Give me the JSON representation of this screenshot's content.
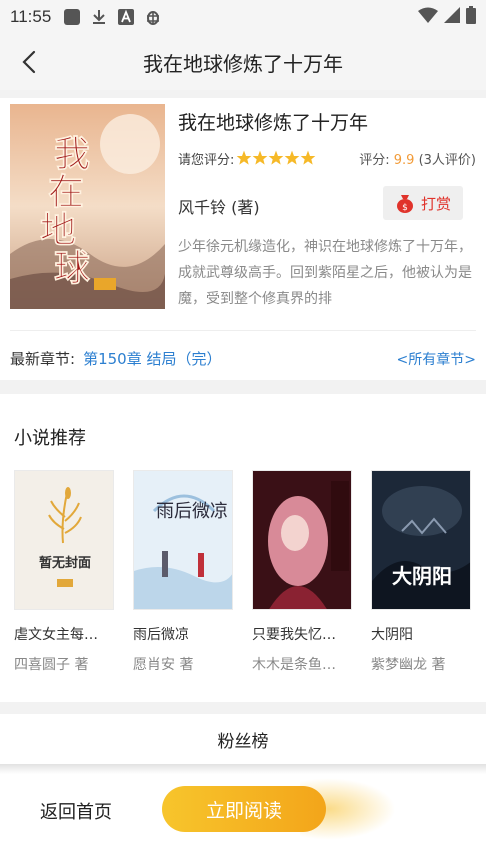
{
  "status_bar": {
    "time": "11:55",
    "icons_left": [
      "app-square-icon",
      "download-icon",
      "a-badge-icon",
      "bug-icon"
    ],
    "icons_right": [
      "wifi-icon",
      "signal-icon",
      "battery-icon"
    ]
  },
  "nav": {
    "title": "我在地球修炼了十万年"
  },
  "book": {
    "title": "我在地球修炼了十万年",
    "rating_label": "请您评分:",
    "stars": 5,
    "score_label": "评分:",
    "score_value": "9.9",
    "score_count": "(3人评价)",
    "author": "风千铃 (著)",
    "reward_label": "打赏",
    "description": "少年徐元机缘造化，神识在地球修炼了十万年，成就武尊级高手。回到紫陌星之后，他被认为是魔，受到整个修真界的排",
    "latest_label": "最新章节:",
    "latest_chapter": "第150章 结局（完）",
    "all_chapters": "<所有章节>",
    "cover": {
      "title_chars": [
        "我",
        "在",
        "地",
        "球"
      ]
    }
  },
  "recommend": {
    "heading": "小说推荐",
    "books": [
      {
        "name": "虐文女主每…",
        "author": "四喜圆子 著",
        "cover_text": "暂无封面"
      },
      {
        "name": "雨后微凉",
        "author": "愿肖安 著",
        "cover_text": "雨后微凉"
      },
      {
        "name": "只要我失忆…",
        "author": "木木是条鱼…",
        "cover_text": ""
      },
      {
        "name": "大阴阳",
        "author": "紫梦幽龙 著",
        "cover_text": "大阴阳"
      }
    ]
  },
  "fans": {
    "title": "粉丝榜"
  },
  "bottom": {
    "home_label": "返回首页",
    "read_label": "立即阅读"
  },
  "colors": {
    "accent_orange": "#f3a51a",
    "link_blue": "#2c7fd0",
    "reward_red": "#e0332b",
    "score_orange": "#f29b38"
  }
}
